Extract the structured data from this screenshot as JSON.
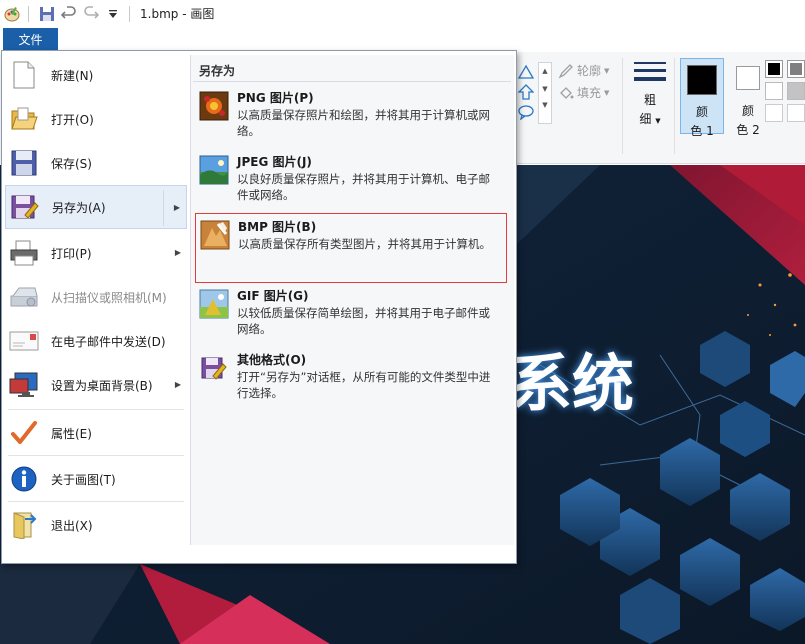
{
  "window": {
    "title": "1.bmp - 画图"
  },
  "tabs": {
    "file": "文件"
  },
  "ribbon": {
    "outline_label": "轮廓",
    "fill_label": "填充",
    "size_label_1": "粗",
    "size_label_2": "细",
    "color1_label_1": "颜",
    "color1_label_2": "色 1",
    "color2_label_1": "颜",
    "color2_label_2": "色 2"
  },
  "menu": {
    "items": [
      {
        "label": "新建(N)",
        "icon": "new-document-icon"
      },
      {
        "label": "打开(O)",
        "icon": "open-folder-icon"
      },
      {
        "label": "保存(S)",
        "icon": "save-disk-icon"
      },
      {
        "label": "另存为(A)",
        "icon": "save-as-icon"
      },
      {
        "label": "打印(P)",
        "icon": "printer-icon"
      },
      {
        "label": "从扫描仪或照相机(M)",
        "icon": "scanner-icon"
      },
      {
        "label": "在电子邮件中发送(D)",
        "icon": "email-icon"
      },
      {
        "label": "设置为桌面背景(B)",
        "icon": "desktop-icon"
      },
      {
        "label": "属性(E)",
        "icon": "checkmark-icon"
      },
      {
        "label": "关于画图(T)",
        "icon": "info-icon"
      },
      {
        "label": "退出(X)",
        "icon": "exit-icon"
      }
    ]
  },
  "submenu": {
    "title": "另存为",
    "items": [
      {
        "name": "PNG 图片(P)",
        "desc": "以高质量保存照片和绘图，并将其用于计算机或网络。"
      },
      {
        "name": "JPEG 图片(J)",
        "desc": "以良好质量保存照片，并将其用于计算机、电子邮件或网络。"
      },
      {
        "name": "BMP 图片(B)",
        "desc": "以高质量保存所有类型图片，并将其用于计算机。"
      },
      {
        "name": "GIF 图片(G)",
        "desc": "以较低质量保存简单绘图，并将其用于电子邮件或网络。"
      },
      {
        "name": "其他格式(O)",
        "desc": "打开“另存为”对话框，从所有可能的文件类型中进行选择。"
      }
    ]
  },
  "canvas": {
    "visible_text": "系统"
  },
  "colors": {
    "accent": "#1a5fa8",
    "highlight_border": "#e03c3c",
    "menu_hover": "#e6eef8"
  }
}
